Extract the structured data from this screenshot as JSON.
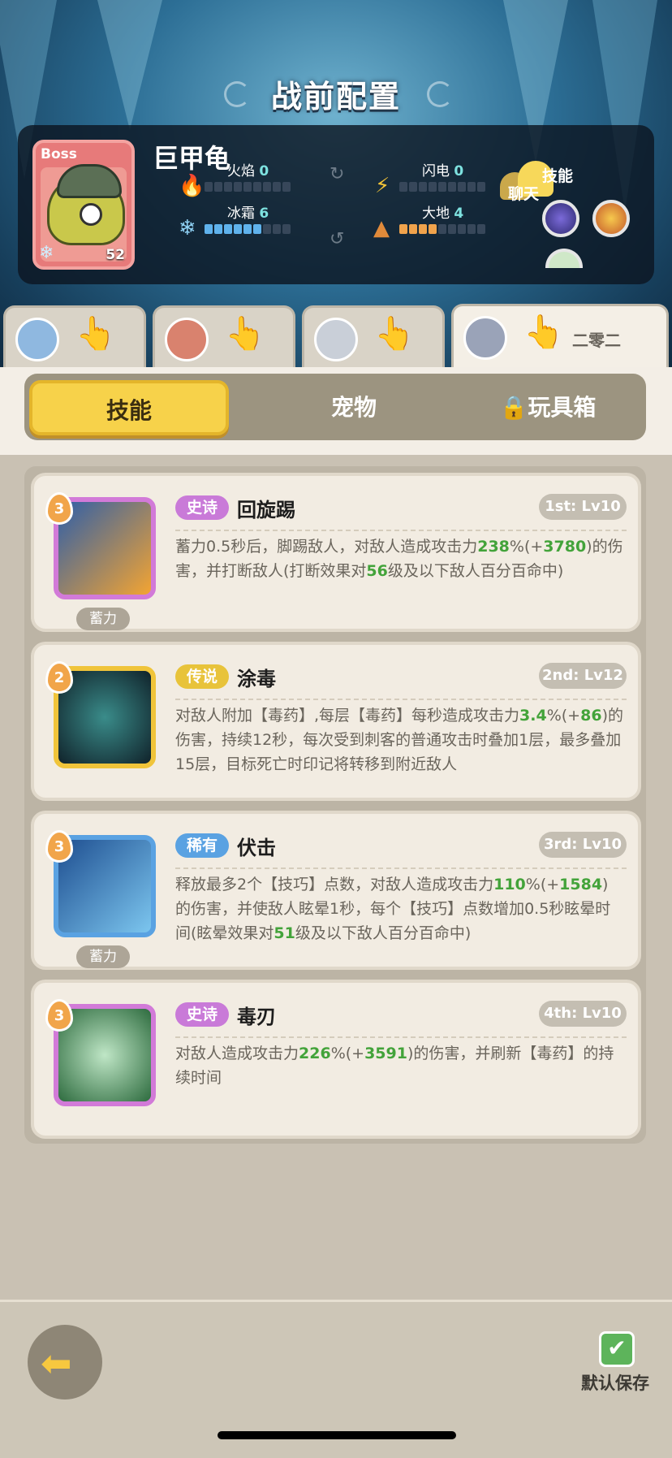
{
  "header": {
    "title": "战前配置"
  },
  "boss": {
    "tag": "Boss",
    "name": "巨甲龟",
    "level": "52",
    "elements": [
      {
        "label": "火焰",
        "value": "0"
      },
      {
        "label": "闪电",
        "value": "0"
      },
      {
        "label": "冰霜",
        "value": "6"
      },
      {
        "label": "大地",
        "value": "4"
      }
    ],
    "chat_label": "聊天",
    "skill_label": "技能"
  },
  "hero_tabs": [
    {
      "label": ""
    },
    {
      "label": ""
    },
    {
      "label": ""
    },
    {
      "label": "二零二"
    }
  ],
  "tabs": [
    {
      "label": "技能",
      "active": true
    },
    {
      "label": "宠物",
      "active": false
    },
    {
      "label": "玩具箱",
      "locked": true
    }
  ],
  "skills": [
    {
      "rank": "3",
      "rarity": "史诗",
      "rarity_color": "#c97ad8",
      "name": "回旋踢",
      "level": "1st: Lv10",
      "charge": "蓄力",
      "desc_parts": [
        "蓄力0.5秒后，脚踢敌人，对敌人造成攻击力",
        "238",
        "%(+",
        "3780",
        ")的伤害，并打断敌人(打断效果对",
        "56",
        "级及以下敌人百分百命中)"
      ]
    },
    {
      "rank": "2",
      "rarity": "传说",
      "rarity_color": "#e8c33a",
      "name": "涂毒",
      "level": "2nd: Lv12",
      "charge": "",
      "desc_parts": [
        "对敌人附加【毒药】,每层【毒药】每秒造成攻击力",
        "3.4",
        "%(+",
        "86",
        ")的伤害，持续12秒，每次受到刺客的普通攻击时叠加1层，最多叠加15层，目标死亡时印记将转移到附近敌人",
        "",
        ""
      ]
    },
    {
      "rank": "3",
      "rarity": "稀有",
      "rarity_color": "#5aa2e2",
      "name": "伏击",
      "level": "3rd: Lv10",
      "charge": "蓄力",
      "desc_parts": [
        "释放最多2个【技巧】点数，对敌人造成攻击力",
        "110",
        "%(+",
        "1584",
        ")的伤害，并使敌人眩晕1秒，每个【技巧】点数增加0.5秒眩晕时间(眩晕效果对",
        "51",
        "级及以下敌人百分百命中)"
      ]
    },
    {
      "rank": "3",
      "rarity": "史诗",
      "rarity_color": "#c97ad8",
      "name": "毒刃",
      "level": "4th: Lv10",
      "charge": "",
      "desc_parts": [
        "对敌人造成攻击力",
        "226",
        "%(+",
        "3591",
        ")的伤害，并刷新【毒药】的持续时间",
        "",
        ""
      ]
    }
  ],
  "footer": {
    "save_label": "默认保存"
  }
}
